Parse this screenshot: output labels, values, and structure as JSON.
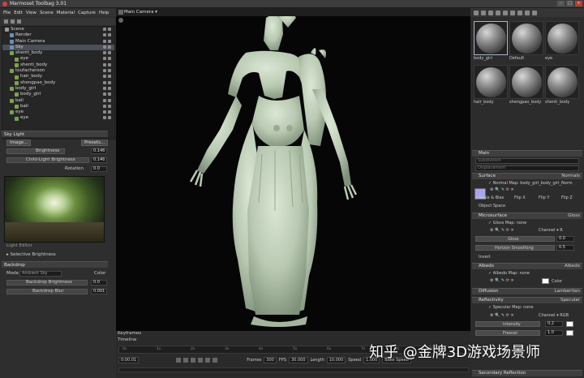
{
  "app": {
    "title": "Marmoset Toolbag 3.01"
  },
  "menu": [
    "File",
    "Edit",
    "View",
    "Scene",
    "Material",
    "Capture",
    "Help"
  ],
  "outliner": {
    "items": [
      {
        "label": "Scene",
        "indent": 0,
        "icon": "scene-icon"
      },
      {
        "label": "Render",
        "indent": 1,
        "icon": "render-icon"
      },
      {
        "label": "Main Camera",
        "indent": 1,
        "icon": "camera-icon"
      },
      {
        "label": "Sky",
        "indent": 1,
        "icon": "sky-icon",
        "selected": true
      },
      {
        "label": "shenti_body",
        "indent": 1,
        "icon": "mesh-icon"
      },
      {
        "label": "eye",
        "indent": 2,
        "icon": "mesh-icon"
      },
      {
        "label": "shenti_body",
        "indent": 2,
        "icon": "mesh-icon"
      },
      {
        "label": "toufacherson",
        "indent": 1,
        "icon": "mesh-icon"
      },
      {
        "label": "hair_body",
        "indent": 2,
        "icon": "mesh-icon"
      },
      {
        "label": "shengpao_body",
        "indent": 2,
        "icon": "mesh-icon"
      },
      {
        "label": "body_girl",
        "indent": 1,
        "icon": "mesh-icon"
      },
      {
        "label": "body_girl",
        "indent": 2,
        "icon": "mesh-icon"
      },
      {
        "label": "bali",
        "indent": 1,
        "icon": "mesh-icon"
      },
      {
        "label": "bali",
        "indent": 2,
        "icon": "mesh-icon"
      },
      {
        "label": "eye",
        "indent": 1,
        "icon": "mesh-icon"
      },
      {
        "label": "eye",
        "indent": 2,
        "icon": "mesh-icon"
      }
    ]
  },
  "sky_light": {
    "header": "Sky Light",
    "image_button": "Image...",
    "presets_button": "Presets...",
    "brightness_label": "Brightness",
    "brightness_value": "0.146",
    "child_brightness_label": "Child-Light Brightness",
    "child_brightness_value": "0.146",
    "rotation_label": "Rotation",
    "rotation_value": "0.0",
    "light_editor": "Light Editor",
    "selective_brightness": "Selective Brightness"
  },
  "backdrop": {
    "header": "Backdrop",
    "mode_label": "Mode",
    "mode_value": "Ambient Sky",
    "color_label": "Color",
    "brightness_label": "Backdrop Brightness",
    "brightness_value": "0.0",
    "blur_label": "Backdrop Blur",
    "blur_value": "0.001"
  },
  "viewport": {
    "camera": "Main Camera"
  },
  "timeline": {
    "keyframes_label": "Keyframes",
    "timeline_label": "Timeline",
    "start_time": "0:00.01",
    "ticks": [
      "0s",
      "1s",
      "2s",
      "3s",
      "4s",
      "5s",
      "6s",
      "7s",
      "8s",
      "9s",
      "10s"
    ],
    "frames_label": "Frames",
    "frames_value": "300",
    "fps_label": "FPS",
    "fps_value": "30.000",
    "length_label": "Length",
    "length_value": "10.000",
    "speed_label": "Speed",
    "speed_value": "1.000",
    "bake_label": "Bake Speed"
  },
  "materials": [
    {
      "label": "body_girl",
      "selected": true
    },
    {
      "label": "Default"
    },
    {
      "label": "eye"
    },
    {
      "label": "hair_body"
    },
    {
      "label": "shengpao_body"
    },
    {
      "label": "shenti_body"
    }
  ],
  "material_panel": {
    "main_header": "Main",
    "subdivision": "Subdivision",
    "displacement": "Displacement",
    "surface_header": "Surface",
    "surface_value": "Normals",
    "normal_map_label": "Normal Map:",
    "normal_map_value": "body_girl_body_girl_Norm",
    "scale_bias": "Scale & Bias",
    "flip_x": "Flip X",
    "flip_y": "Flip Y",
    "flip_z": "Flip Z",
    "object_space": "Object Space",
    "microsurface_header": "Microsurface",
    "microsurface_value": "Gloss",
    "gloss_map_label": "Gloss Map:",
    "gloss_map_value": "none",
    "channel_label": "Channel",
    "channel_value": "R",
    "gloss_label": "Gloss",
    "gloss_value": "0.0",
    "horizon_label": "Horizon Smoothing",
    "horizon_value": "0.5",
    "invert_label": "Invert",
    "albedo_header": "Albedo",
    "albedo_value": "Albedo",
    "albedo_map_label": "Albedo Map:",
    "albedo_map_value": "none",
    "color_label": "Color",
    "diffusion_header": "Diffusion",
    "diffusion_value": "Lambertian",
    "reflectivity_header": "Reflectivity",
    "reflectivity_value": "Specular",
    "specular_map_label": "Specular Map:",
    "specular_map_value": "none",
    "spec_channel_value": "RGB",
    "intensity_label": "Intensity",
    "intensity_value": "0.2",
    "fresnel_label": "Fresnel",
    "fresnel_value": "1.0",
    "secondary_reflection": "Secondary Reflection"
  },
  "watermark": "知乎 @金牌3D游戏场景师",
  "colors": {
    "normal_map_swatch": "#a8a4ee",
    "viewport_bg": "#060606",
    "model": "#c3d2bc"
  }
}
